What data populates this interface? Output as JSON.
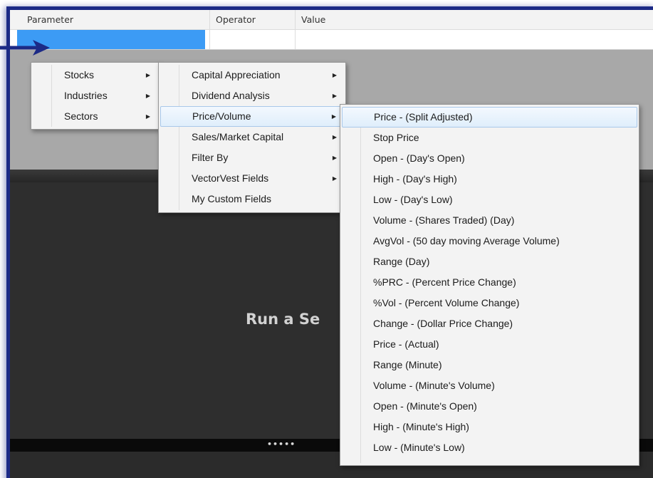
{
  "grid": {
    "headers": [
      {
        "label": "Parameter"
      },
      {
        "label": "Operator"
      },
      {
        "label": "Value"
      }
    ]
  },
  "main": {
    "run_text": "Run a Se",
    "splitter_dots": "•••••"
  },
  "menu_root": {
    "items": [
      {
        "label": "Stocks"
      },
      {
        "label": "Industries"
      },
      {
        "label": "Sectors"
      }
    ]
  },
  "menu_stocks": {
    "items": [
      {
        "label": "Capital Appreciation"
      },
      {
        "label": "Dividend Analysis"
      },
      {
        "label": "Price/Volume"
      },
      {
        "label": "Sales/Market Capital"
      },
      {
        "label": "Filter By"
      },
      {
        "label": "VectorVest Fields"
      },
      {
        "label": "My Custom Fields"
      }
    ]
  },
  "menu_price_volume": {
    "items": [
      {
        "label": "Price - (Split Adjusted)"
      },
      {
        "label": "Stop Price"
      },
      {
        "label": "Open - (Day's Open)"
      },
      {
        "label": "High - (Day's High)"
      },
      {
        "label": "Low - (Day's Low)"
      },
      {
        "label": "Volume - (Shares Traded) (Day)"
      },
      {
        "label": "AvgVol - (50 day moving Average Volume)"
      },
      {
        "label": "Range (Day)"
      },
      {
        "label": "%PRC - (Percent Price Change)"
      },
      {
        "label": "%Vol - (Percent Volume Change)"
      },
      {
        "label": "Change - (Dollar Price Change)"
      },
      {
        "label": "Price - (Actual)"
      },
      {
        "label": "Range (Minute)"
      },
      {
        "label": "Volume - (Minute's Volume)"
      },
      {
        "label": "Open - (Minute's Open)"
      },
      {
        "label": "High - (Minute's High)"
      },
      {
        "label": "Low - (Minute's Low)"
      }
    ]
  },
  "icons": {
    "submenu_arrow": "submenu-arrow-icon",
    "pointer": "pointer-arrow-icon"
  },
  "colors": {
    "frame_border": "#1c2a86",
    "selected_cell": "#3c9bf5",
    "menu_highlight": "#dfeefb"
  }
}
